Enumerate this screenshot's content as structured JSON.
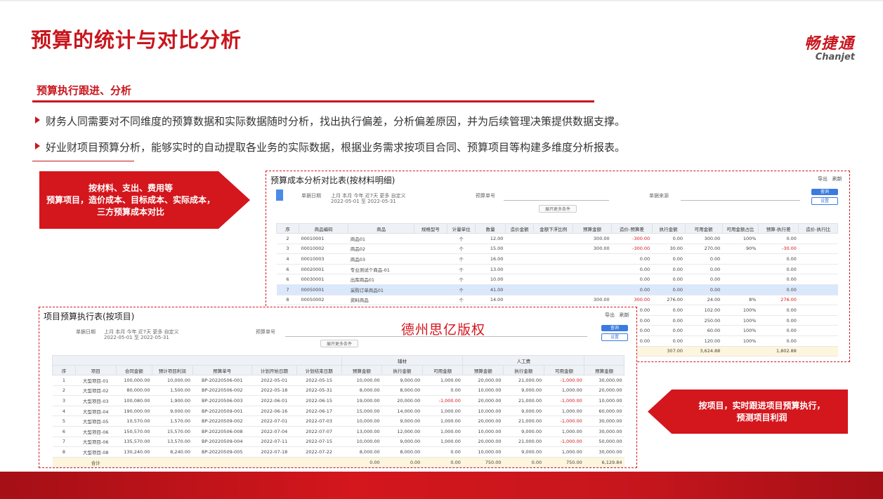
{
  "slide": {
    "title": "预算的统计与对比分析",
    "logo_cn": "畅捷通",
    "logo_en": "Chanjet",
    "subtitle": "预算执行跟进、分析",
    "bullets": [
      "财务人同需要对不同维度的预算数据和实际数据随时分析，找出执行偏差，分析偏差原因，并为后续管理决策提供数据支撑。",
      "好业财项目预算分析，能够实时的自动提取各业务的实际数据，根据业务需求按项目合同、预算项目等构建多维度分析报表。"
    ],
    "callout1": [
      "按材料、支出、费用等",
      "预算项目，造价成本、目标成本、实际成本，",
      "三方预算成本对比"
    ],
    "callout2": [
      "按项目，实时跟进项目预算执行，",
      "预测项目利润"
    ],
    "watermark": "德州思亿版权",
    "accent_color": "#c8161d"
  },
  "report1": {
    "title": "预算成本分析对比表(按材料明细)",
    "tools": "导出　刷新",
    "filter_date_label": "单据日期",
    "filter_date_opts": "上月  本月  今年  近7天  更多  自定义",
    "filter_date_range": "2022-05-01 至 2022-05-31",
    "filter_budget_label": "预算单号",
    "filter_type_label": "单据来源",
    "btn_search": "查询",
    "btn_setting": "设置",
    "expand": "展开更多条件",
    "columns": [
      "序",
      "商品编码",
      "商品",
      "规格型号",
      "计量单位",
      "数量",
      "造价金额",
      "金额下浮比例",
      "预算金额",
      "造价-预算差",
      "执行金额",
      "可用金额",
      "可用金额占比",
      "预算-执行差",
      "造价-执行比"
    ],
    "rows": [
      [
        "2",
        "00010001",
        "商品01",
        "",
        "个",
        "12.00",
        "",
        "",
        "300.00",
        "-300.00",
        "0.00",
        "300.00",
        "100%",
        "0.00",
        ""
      ],
      [
        "3",
        "00010002",
        "商品02",
        "",
        "个",
        "15.00",
        "",
        "",
        "300.00",
        "-300.00",
        "30.00",
        "270.00",
        "90%",
        "-30.00",
        ""
      ],
      [
        "4",
        "00010003",
        "商品03",
        "",
        "个",
        "16.00",
        "",
        "",
        "",
        "0.00",
        "0.00",
        "0.00",
        "",
        "0.00",
        ""
      ],
      [
        "6",
        "00020001",
        "专业测试个商品-01",
        "",
        "个",
        "13.00",
        "",
        "",
        "",
        "0.00",
        "0.00",
        "0.00",
        "",
        "0.00",
        ""
      ],
      [
        "6",
        "00030001",
        "出库商品01",
        "",
        "个",
        "10.00",
        "",
        "",
        "",
        "0.00",
        "0.00",
        "0.00",
        "",
        "0.00",
        ""
      ],
      [
        "7",
        "00050001",
        "采购订单商品01",
        "",
        "个",
        "41.00",
        "",
        "",
        "",
        "0.00",
        "0.00",
        "0.00",
        "",
        "0.00",
        ""
      ],
      [
        "8",
        "00050002",
        "资料商品",
        "",
        "个",
        "14.00",
        "",
        "",
        "300.00",
        "300.00",
        "276.00",
        "24.00",
        "8%",
        "276.00",
        ""
      ],
      [
        "",
        "",
        "",
        "",
        "",
        "",
        "",
        "",
        "",
        "0.00",
        "0.00",
        "102.00",
        "100%",
        "0.00",
        ""
      ],
      [
        "",
        "",
        "",
        "",
        "",
        "",
        "",
        "",
        "",
        "0.00",
        "0.00",
        "250.00",
        "100%",
        "0.00",
        ""
      ],
      [
        "",
        "",
        "",
        "",
        "",
        "",
        "",
        "",
        "",
        "0.00",
        "0.00",
        "60.00",
        "100%",
        "0.00",
        ""
      ],
      [
        "",
        "",
        "",
        "",
        "",
        "",
        "",
        "",
        "",
        "0.00",
        "0.00",
        "120.00",
        "100%",
        "0.00",
        ""
      ]
    ],
    "sum_row": [
      "",
      "",
      "",
      "",
      "",
      "",
      "",
      "",
      "",
      "",
      "307.00",
      "3,624.88",
      "",
      "1,802.88",
      ""
    ]
  },
  "report2": {
    "title": "项目预算执行表(按项目)",
    "tools": "导出　刷新",
    "filter_date_label": "单据日期",
    "filter_date_opts": "上月  本月  今年  近7天  更多  自定义",
    "filter_date_range": "2022-05-01 至 2022-05-31",
    "filter_budget_label": "预算单号",
    "btn_search": "查询",
    "btn_setting": "设置",
    "expand": "展开更多条件",
    "group_headers": [
      "辅材",
      "人工费"
    ],
    "columns": [
      "序",
      "项目",
      "合同金额",
      "预计项目利润",
      "预算单号",
      "计划开始日期",
      "计划结束日期",
      "预算金额",
      "执行金额",
      "可用金额",
      "预算金额",
      "执行金额",
      "可用金额",
      "预算金额"
    ],
    "rows": [
      [
        "1",
        "大型项目-01",
        "100,000.00",
        "10,000.00",
        "BP-20220506-001",
        "2022-05-01",
        "2022-05-15",
        "10,000.00",
        "9,000.00",
        "1,000.00",
        "20,000.00",
        "21,000.00",
        "-1,000.00",
        "30,000.00"
      ],
      [
        "2",
        "大型项目-02",
        "80,000.00",
        "1,500.00",
        "BP-20220506-002",
        "2022-05-18",
        "2022-05-31",
        "8,000.00",
        "8,000.00",
        "0.00",
        "10,000.00",
        "9,000.00",
        "1,000.00",
        "20,000.00"
      ],
      [
        "3",
        "大型项目-03",
        "100,080.00",
        "1,900.00",
        "BP-20220506-003",
        "2022-06-01",
        "2022-06-15",
        "19,000.00",
        "20,000.00",
        "-1,000.00",
        "20,000.00",
        "21,000.00",
        "-1,000.00",
        "10,000.00"
      ],
      [
        "4",
        "大型项目-04",
        "190,000.00",
        "9,000.00",
        "BP-20220509-001",
        "2022-06-16",
        "2022-06-17",
        "15,000.00",
        "14,000.00",
        "1,000.00",
        "10,000.00",
        "9,000.00",
        "1,000.00",
        "60,000.00"
      ],
      [
        "5",
        "大型项目-05",
        "10,570.00",
        "1,570.00",
        "BP-20220509-002",
        "2022-07-01",
        "2022-07-03",
        "10,000.00",
        "9,000.00",
        "1,000.00",
        "20,000.00",
        "21,000.00",
        "-1,000.00",
        "30,000.00"
      ],
      [
        "6",
        "大型项目-06",
        "150,570.00",
        "15,570.00",
        "BP-20220506-008",
        "2022-07-04",
        "2022-07-07",
        "13,000.00",
        "12,000.00",
        "1,000.00",
        "10,000.00",
        "9,000.00",
        "1,000.00",
        "30,000.00"
      ],
      [
        "7",
        "大型项目-06",
        "135,570.00",
        "13,570.00",
        "BP-20220509-004",
        "2022-07-11",
        "2022-07-15",
        "10,000.00",
        "9,000.00",
        "1,000.00",
        "20,000.00",
        "21,000.00",
        "-1,000.00",
        "50,000.00"
      ],
      [
        "8",
        "大型项目-08",
        "130,240.00",
        "8,240.00",
        "BP-20220509-005",
        "2022-07-18",
        "2022-07-22",
        "8,000.00",
        "8,000.00",
        "0.00",
        "10,000.00",
        "9,000.00",
        "1,000.00",
        "30,000.00"
      ]
    ],
    "sum_row": [
      "",
      "合计",
      "",
      "",
      "",
      "",
      "",
      "0.00",
      "0.00",
      "0.00",
      "750.00",
      "0.00",
      "750.00",
      "6,129.84"
    ]
  }
}
